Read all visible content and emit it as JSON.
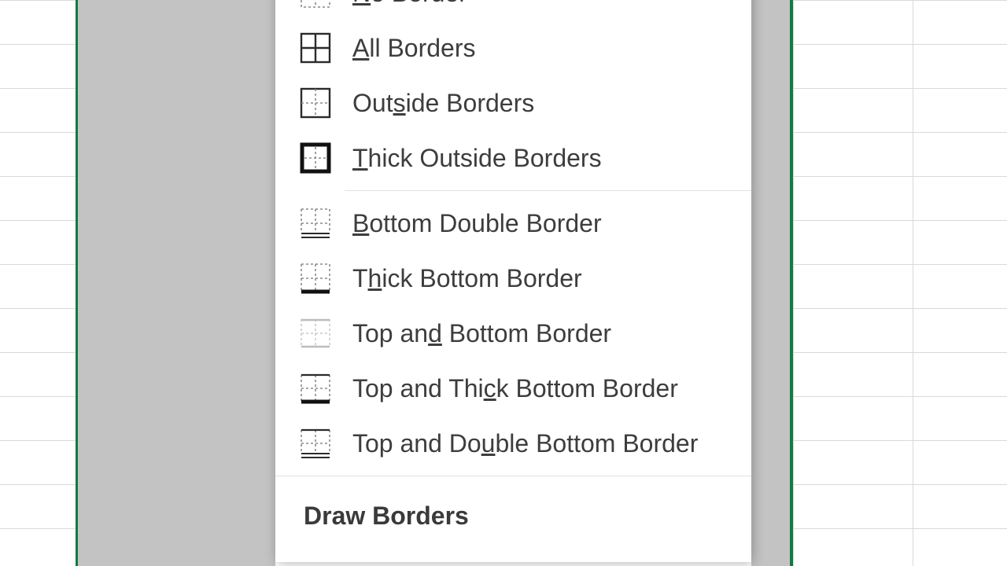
{
  "menu": {
    "items": [
      {
        "key": "no-border",
        "pre": "",
        "u": "N",
        "post": "o Border"
      },
      {
        "key": "all-borders",
        "pre": "",
        "u": "A",
        "post": "ll Borders"
      },
      {
        "key": "outside-borders",
        "pre": "Out",
        "u": "s",
        "post": "ide Borders"
      },
      {
        "key": "thick-outside-borders",
        "pre": "",
        "u": "T",
        "post": "hick Outside Borders"
      },
      {
        "key": "bottom-double-border",
        "pre": "",
        "u": "B",
        "post": "ottom Double Border"
      },
      {
        "key": "thick-bottom-border",
        "pre": "T",
        "u": "h",
        "post": "ick Bottom Border"
      },
      {
        "key": "top-and-bottom-border",
        "pre": "Top an",
        "u": "d",
        "post": " Bottom Border"
      },
      {
        "key": "top-thick-bottom-border",
        "pre": "Top and Thi",
        "u": "c",
        "post": "k Bottom Border"
      },
      {
        "key": "top-double-bottom-border",
        "pre": "Top and Do",
        "u": "u",
        "post": "ble Bottom Border"
      }
    ],
    "section_header": "Draw Borders"
  }
}
